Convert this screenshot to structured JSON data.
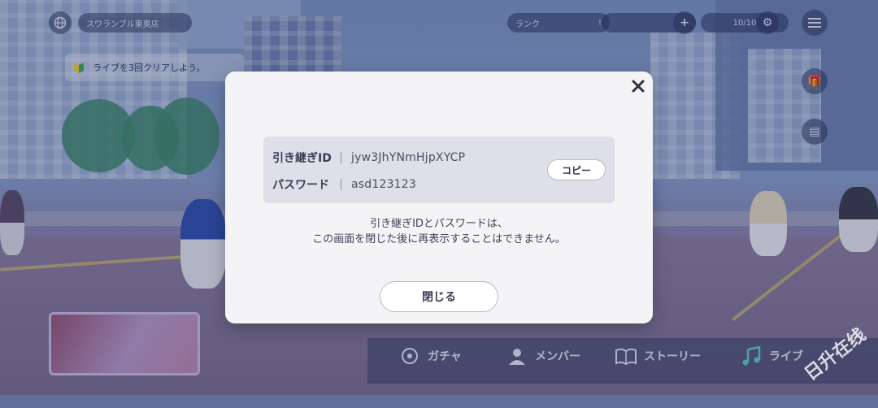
{
  "background": {
    "top_left_label": "スワランブル東奥店",
    "mission_text": "ライブを3回クリアしよう。",
    "hud": {
      "rank_label": "ランク",
      "rank_value": "!",
      "stamina": "10/10"
    },
    "nav": [
      {
        "label": "ガチャ",
        "icon": "gacha-icon"
      },
      {
        "label": "メンバー",
        "icon": "member-icon"
      },
      {
        "label": "ストーリー",
        "icon": "story-icon"
      },
      {
        "label": "ライブ",
        "icon": "music-note-icon"
      }
    ],
    "watermark": "日升在线"
  },
  "dialog": {
    "id_label": "引き継ぎID",
    "id_value": "jyw3JhYNmHjpXYCP",
    "password_label": "パスワード",
    "password_value": "asd123123",
    "copy_button": "コピー",
    "notice_line1": "引き継ぎIDとパスワードは、",
    "notice_line2": "この画面を閉じた後に再表示することはできません。",
    "close_button": "閉じる",
    "close_icon": "close-icon"
  },
  "colors": {
    "modal_bg": "#f4f4f7",
    "info_box_bg": "#dedfe8",
    "text_dark": "#3b3d55"
  }
}
